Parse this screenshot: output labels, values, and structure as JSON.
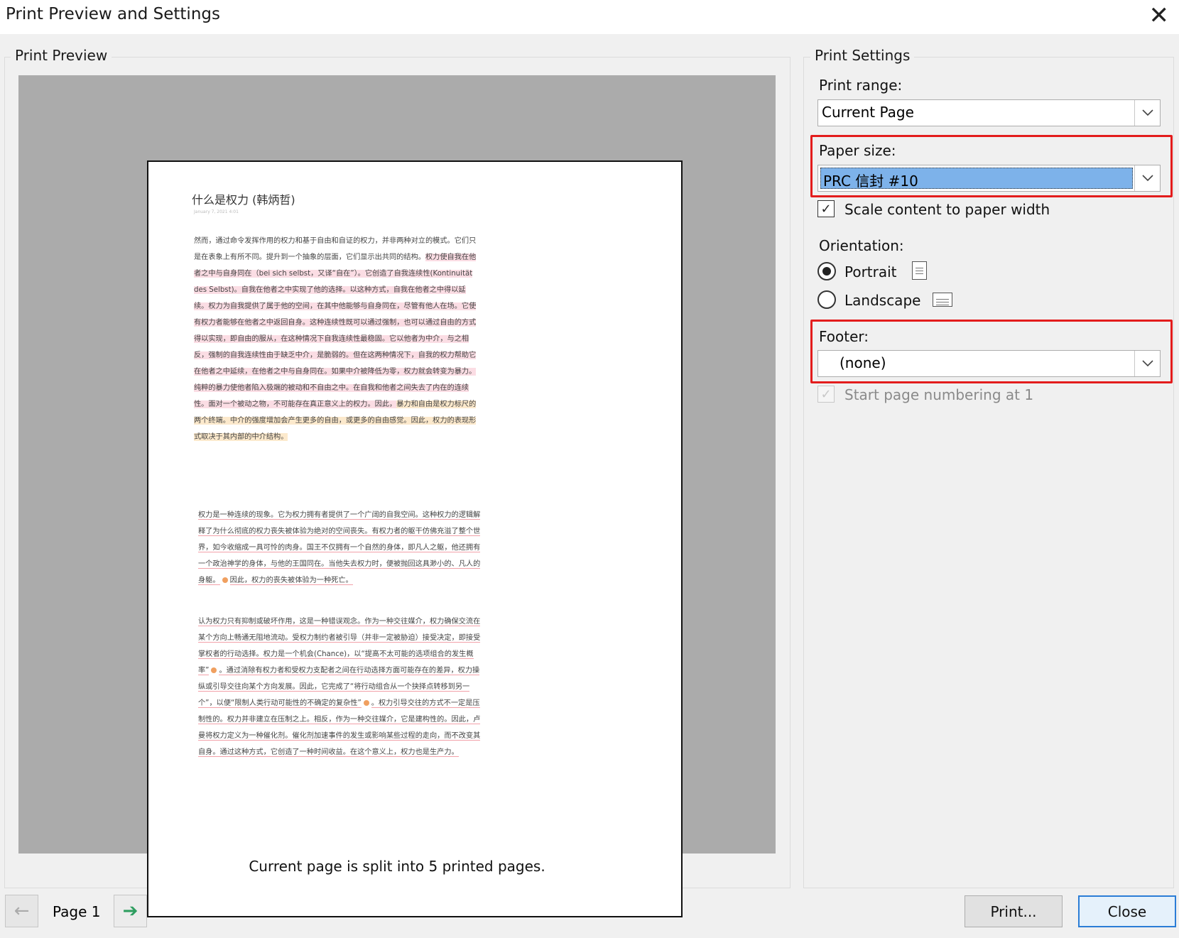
{
  "window": {
    "title": "Print Preview and Settings",
    "close_glyph": "✕"
  },
  "preview": {
    "group_label": "Print Preview",
    "status": "Current page is split into 5 printed pages.",
    "sheet": {
      "title": "什么是权力 (韩炳哲)",
      "date": "January 7, 2021    4:01",
      "para1_normal": "然而，通过命令发挥作用的权力和基于自由和自证的权力，并非两种对立的模式。它们只是在表象上有所不同。提升到一个抽象的层面，它们显示出共同的结构。",
      "para1_pink": "权力使自我在他者之中与自身同在（bei sich selbst，又译“自在”）。它创造了自我连续性(Kontinuität des Selbst)。自我在他者之中实现了他的选择。以这种方式，自我在他者之中得以延续。权力为自我提供了属于他的空间，在其中他能够与自身同在，尽管有他人在场。它使有权力者能够在他者之中返回自身。这种连续性既可以通过强制，也可以通过自由的方式得以实现，即自由的服从，在这种情况下自我连续性最稳固。它以他者为中介，与之相反，强制的自我连续性由于缺乏中介，是脆弱的。但在这两种情况下，自我的权力帮助它在他者之中延续，在他者之中与自身同在。如果中介被降低为零，权力就会转变为暴力。纯粹的暴力使他者陷入极端的被动和不自由之中。在自我和他者之间失去了内在的连续性。面对一个被动之物，不可能存在真正意义上的权力。因此，",
      "para1_orange": "暴力和自由是权力标尺的两个终端。中介的强度增加会产生更多的自由，或更多的自由感觉。因此，权力的表现形式取决于其内部的中介结构。",
      "para2": "权力是一种连续的现象。它为权力拥有者提供了一个广阔的自我空间。这种权力的逻辑解释了为什么彻底的权力丧失被体验为绝对的空间丧失。有权力者的躯干仿佛充溢了整个世界，如今收缩成一具可怜的肉身。国王不仅拥有一个自然的身体，即凡人之躯，他还拥有一个政治神学的身体，与他的王国同在。当他失去权力时，便被抛回这具渺小的、凡人的身躯。",
      "para2_tail": "因此，权力的丧失被体验为一种死亡。",
      "para3a": "认为权力只有抑制或破坏作用，这是一种错误观念。作为一种交往媒介，权力确保交流在某个方向上畅通无阻地流动。受权力制约者被引导（并非一定被胁迫）接受决定，即接受掌权者的行动选择。权力是一个机会(Chance)，以“提高不太可能的选项组合的发生概率”",
      "para3b": "。通过消除有权力者和受权力支配者之间在行动选择方面可能存在的差异，权力操纵或引导交往向某个方向发展。因此，它完成了“将行动组合从一个抉择点转移到另一个”，以便“限制人类行动可能性的不确定的复杂性”",
      "para3c": "。权力引导交往的方式不一定是压制性的。权力并非建立在压制之上。相反，作为一种交往媒介，它是建构性的。因此，卢曼将权力定义为一种催化剂。催化剂加速事件的发生或影响某些过程的走向，而不改变其自身。通过这种方式，它创造了一种时间收益。在这个意义上，权力也是生产力。"
    }
  },
  "settings": {
    "group_label": "Print Settings",
    "print_range": {
      "label": "Print range:",
      "value": "Current Page"
    },
    "paper_size": {
      "label": "Paper size:",
      "value": "PRC 信封 #10"
    },
    "scale_content": {
      "label": "Scale content to paper width",
      "checked": true
    },
    "orientation": {
      "label": "Orientation:",
      "portrait": "Portrait",
      "landscape": "Landscape",
      "selected": "portrait"
    },
    "footer": {
      "label": "Footer:",
      "value": "(none)"
    },
    "page_numbering": {
      "label": "Start page numbering at 1",
      "checked": true,
      "disabled": true
    },
    "highlight_color": "#e31c1c"
  },
  "nav": {
    "prev_glyph": "←",
    "next_glyph": "➔",
    "page_label": "Page 1"
  },
  "buttons": {
    "print": "Print...",
    "close": "Close"
  },
  "icons": {
    "dropdown": "chevron-down-icon",
    "check": "✓"
  }
}
